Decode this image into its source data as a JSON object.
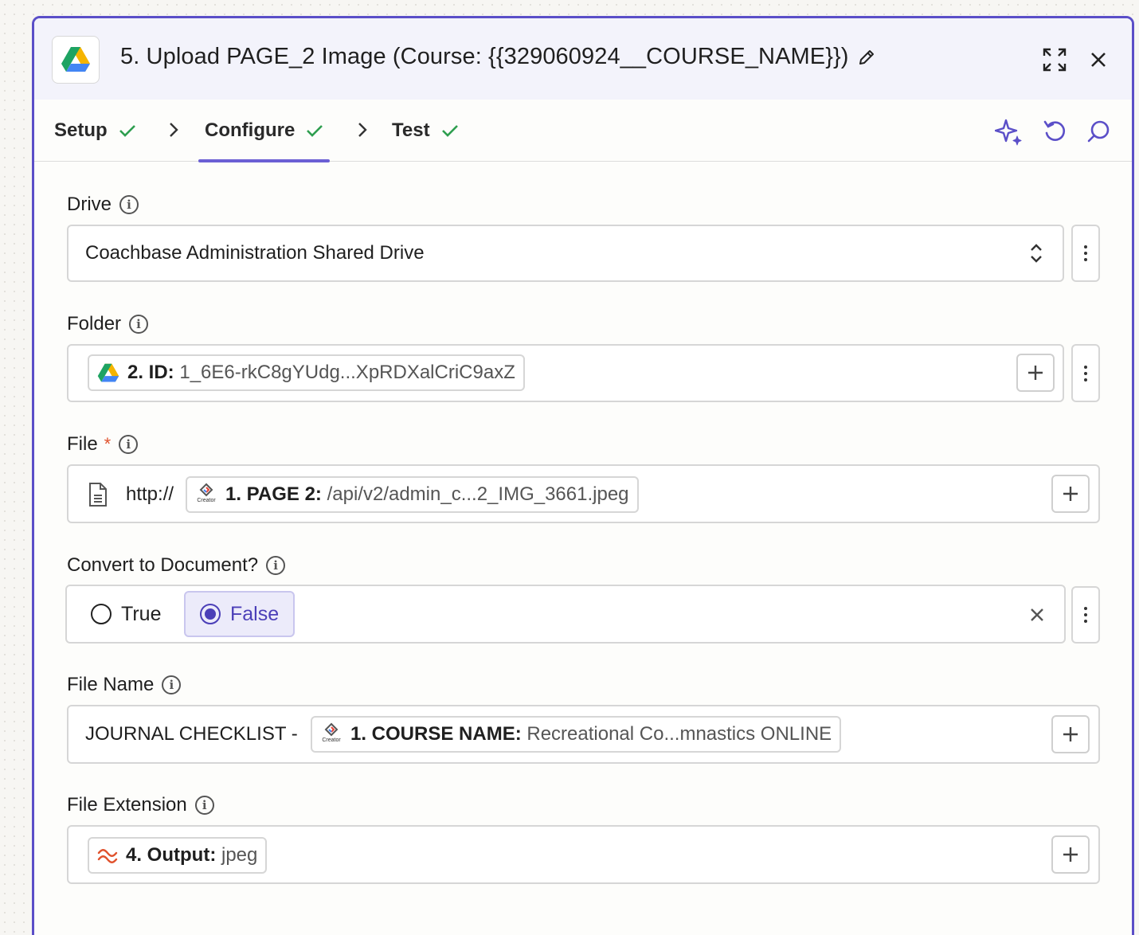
{
  "header": {
    "title": "5. Upload PAGE_2 Image (Course: {{329060924__COURSE_NAME}})",
    "app_icon": "google-drive-icon"
  },
  "tabs": [
    {
      "label": "Setup",
      "done": true
    },
    {
      "label": "Configure",
      "done": true,
      "active": true
    },
    {
      "label": "Test",
      "done": true
    }
  ],
  "toolbar_icons": [
    "sparkle-icon",
    "undo-icon",
    "search-icon"
  ],
  "colors": {
    "accent": "#5b4fc8",
    "check": "#2e9e4f",
    "required": "#e0522d"
  },
  "fields": {
    "drive": {
      "label": "Drive",
      "value": "Coachbase Administration Shared Drive"
    },
    "folder": {
      "label": "Folder",
      "pill_key": "2. ID:",
      "pill_value": "1_6E6-rkC8gYUdg...XpRDXalCriC9axZ"
    },
    "file": {
      "label": "File",
      "required": "*",
      "prefix": "http://",
      "pill_key": "1. PAGE 2:",
      "pill_value": "/api/v2/admin_c...2_IMG_3661.jpeg",
      "pill_icon_text": "Creator"
    },
    "convert": {
      "label": "Convert to Document?",
      "options": [
        "True",
        "False"
      ],
      "selected": "False"
    },
    "file_name": {
      "label": "File Name",
      "prefix": "JOURNAL CHECKLIST -",
      "pill_key": "1. COURSE NAME:",
      "pill_value": "Recreational Co...mnastics ONLINE",
      "pill_icon_text": "Creator"
    },
    "file_extension": {
      "label": "File Extension",
      "pill_key": "4. Output:",
      "pill_value": "jpeg"
    }
  }
}
